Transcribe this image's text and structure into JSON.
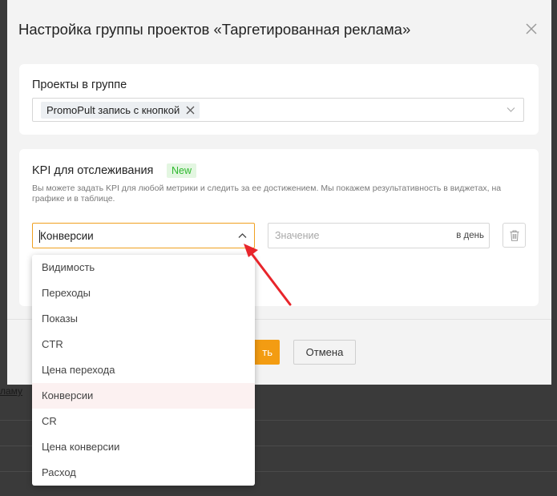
{
  "modal": {
    "title": "Настройка группы проектов «Таргетированная реклама»"
  },
  "projects": {
    "label": "Проекты в группе",
    "selected_chip": "PromoPult запись с кнопкой"
  },
  "kpi": {
    "label": "KPI для отслеживания",
    "badge": "New",
    "description": "Вы можете задать KPI для любой метрики и следить за ее достижением. Мы покажем результативность в виджетах, на графике и в таблице.",
    "selected_metric": "Конверсии",
    "value_placeholder": "Значение",
    "value": "",
    "period": "в день",
    "options": [
      "Видимость",
      "Переходы",
      "Показы",
      "CTR",
      "Цена перехода",
      "Конверсии",
      "CR",
      "Цена конверсии",
      "Расход"
    ],
    "selected_index": 5
  },
  "footer": {
    "save_label": "ть",
    "cancel_label": "Отмена"
  },
  "background": {
    "link_text": "ламу"
  },
  "colors": {
    "accent": "#f39c12",
    "badge_green": "#2eb82e",
    "annotation_arrow": "#e8252b"
  }
}
